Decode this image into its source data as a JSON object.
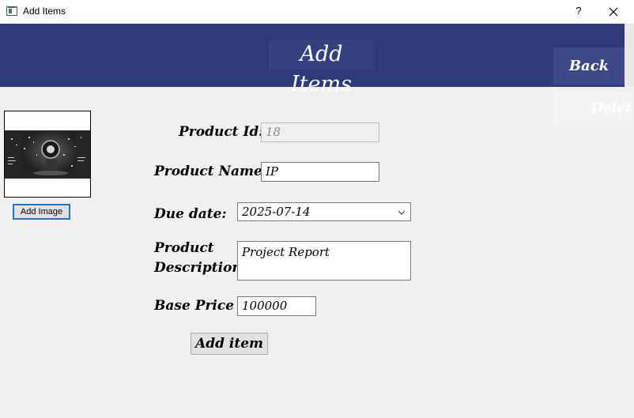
{
  "window": {
    "title": "Add Items",
    "help_label": "?"
  },
  "header": {
    "title": "Add Items",
    "back_label": "Back",
    "delete_label": "Delete"
  },
  "image_panel": {
    "add_image_label": "Add Image"
  },
  "form": {
    "product_id": {
      "label": "Product Id:",
      "value": "18"
    },
    "product_name": {
      "label": "Product Name:",
      "value": "IP"
    },
    "due_date": {
      "label": "Due date:",
      "value": "2025-07-14"
    },
    "description": {
      "label_line1": "Product",
      "label_line2": "Description",
      "value": "Project Report"
    },
    "base_price": {
      "label": "Base Price",
      "value": "100000"
    },
    "submit_label": "Add item"
  },
  "colors": {
    "header_bg": "#2f3a7a",
    "accent_border": "#1f74c8"
  }
}
